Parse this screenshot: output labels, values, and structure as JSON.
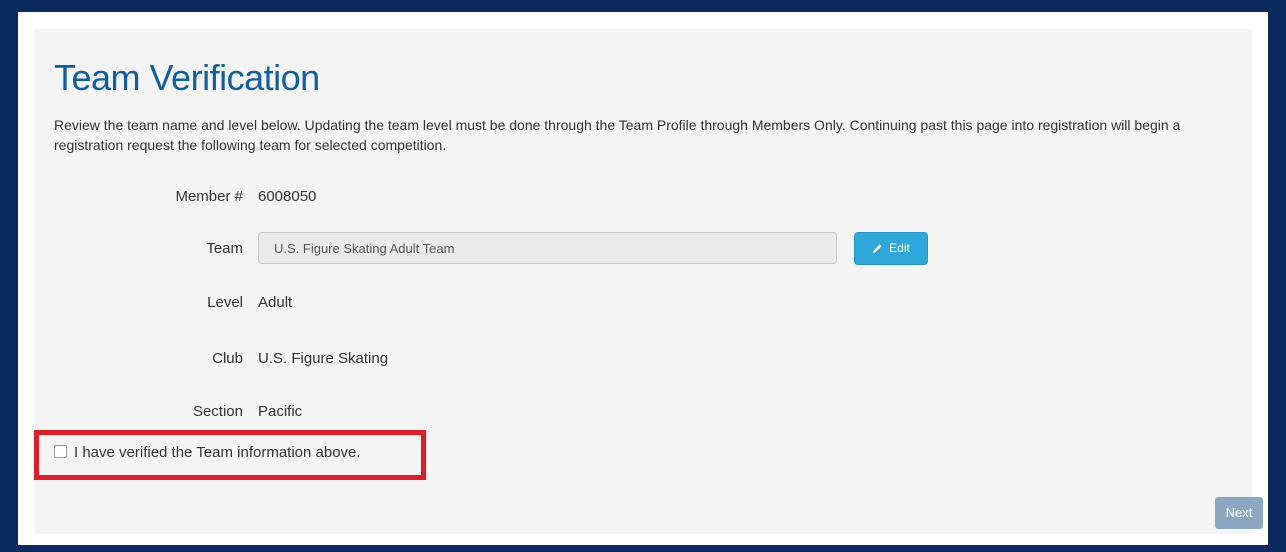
{
  "page": {
    "title": "Team Verification",
    "intro": "Review the team name and level below. Updating the team level must be done through the Team Profile through Members Only. Continuing past this page into registration will begin a registration request the following team for selected competition."
  },
  "fields": {
    "member": {
      "label": "Member #",
      "value": "6008050"
    },
    "team": {
      "label": "Team",
      "value": "U.S. Figure Skating Adult Team",
      "edit_label": "Edit"
    },
    "level": {
      "label": "Level",
      "value": "Adult"
    },
    "club": {
      "label": "Club",
      "value": "U.S. Figure Skating"
    },
    "section": {
      "label": "Section",
      "value": "Pacific"
    }
  },
  "verify": {
    "label": "I have verified the Team information above.",
    "checked": false
  },
  "actions": {
    "next_label": "Next"
  },
  "colors": {
    "title": "#0f5fa8",
    "edit_button": "#2ea8da",
    "next_button": "#8ca7c1",
    "highlight": "#e21b24",
    "frame": "#0b2a5e"
  },
  "icons": {
    "edit": "pencil-icon"
  }
}
